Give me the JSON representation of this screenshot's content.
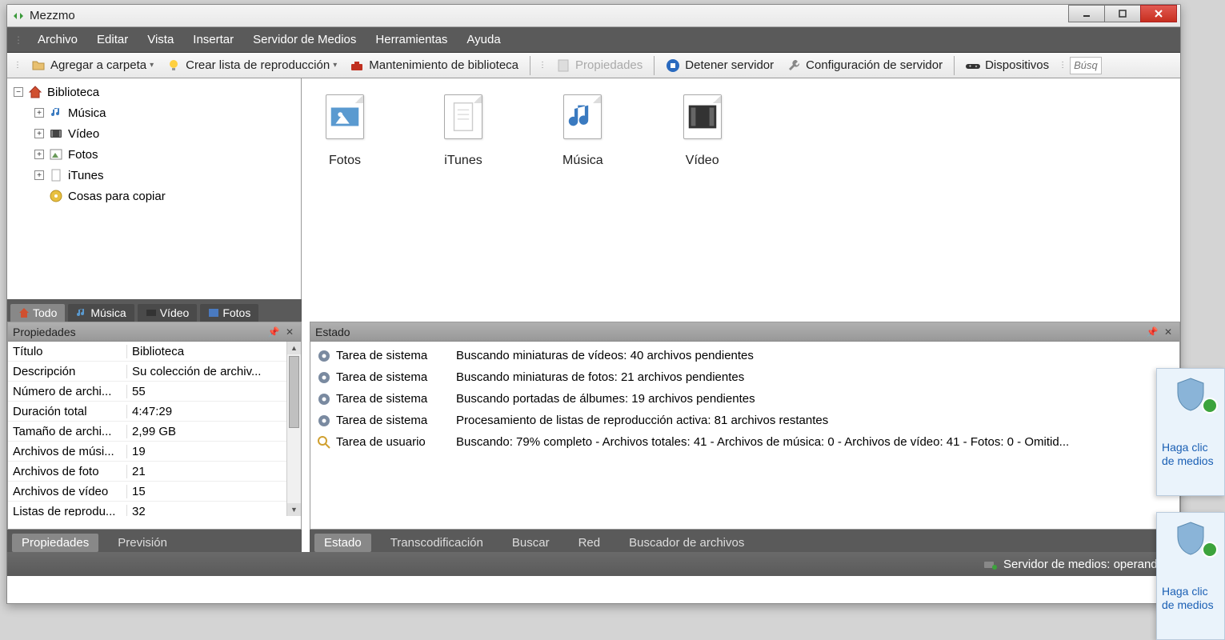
{
  "app": {
    "title": "Mezzmo"
  },
  "menu": [
    "Archivo",
    "Editar",
    "Vista",
    "Insertar",
    "Servidor de Medios",
    "Herramientas",
    "Ayuda"
  ],
  "toolbar": {
    "add_folder": "Agregar a carpeta",
    "create_playlist": "Crear lista de reproducción",
    "maintenance": "Mantenimiento de biblioteca",
    "properties": "Propiedades",
    "stop_server": "Detener servidor",
    "server_config": "Configuración de servidor",
    "devices": "Dispositivos",
    "search_placeholder": "Búsq"
  },
  "tree": {
    "root": "Biblioteca",
    "items": [
      {
        "label": "Música"
      },
      {
        "label": "Vídeo"
      },
      {
        "label": "Fotos"
      },
      {
        "label": "iTunes"
      },
      {
        "label": "Cosas para copiar"
      }
    ]
  },
  "content": [
    {
      "label": "Fotos",
      "icon": "photo"
    },
    {
      "label": "iTunes",
      "icon": "file"
    },
    {
      "label": "Música",
      "icon": "music"
    },
    {
      "label": "Vídeo",
      "icon": "video"
    }
  ],
  "filter_tabs": [
    "Todo",
    "Música",
    "Vídeo",
    "Fotos"
  ],
  "panels": {
    "properties_title": "Propiedades",
    "status_title": "Estado"
  },
  "properties": [
    {
      "k": "Título",
      "v": "Biblioteca"
    },
    {
      "k": "Descripción",
      "v": "Su colección de archiv..."
    },
    {
      "k": "Número de archi...",
      "v": "55"
    },
    {
      "k": "Duración total",
      "v": "4:47:29"
    },
    {
      "k": "Tamaño de archi...",
      "v": "2,99 GB"
    },
    {
      "k": "Archivos de músi...",
      "v": "19"
    },
    {
      "k": "Archivos de foto",
      "v": "21"
    },
    {
      "k": "Archivos de vídeo",
      "v": "15"
    },
    {
      "k": "Listas de reprodu...",
      "v": "32"
    }
  ],
  "status_rows": [
    {
      "kind": "Tarea de sistema",
      "msg": "Buscando miniaturas de vídeos: 40 archivos pendientes",
      "icon": "gear"
    },
    {
      "kind": "Tarea de sistema",
      "msg": "Buscando miniaturas de fotos: 21 archivos pendientes",
      "icon": "gear"
    },
    {
      "kind": "Tarea de sistema",
      "msg": "Buscando portadas de álbumes: 19 archivos pendientes",
      "icon": "gear"
    },
    {
      "kind": "Tarea de sistema",
      "msg": "Procesamiento de listas de reproducción activa: 81 archivos restantes",
      "icon": "gear"
    },
    {
      "kind": "Tarea de usuario",
      "msg": "Buscando: 79% completo - Archivos totales: 41 - Archivos de música: 0 - Archivos de vídeo: 41 - Fotos: 0 - Omitid...",
      "icon": "search"
    }
  ],
  "subtabs_left": [
    "Propiedades",
    "Previsión"
  ],
  "subtabs_right": [
    "Estado",
    "Transcodificación",
    "Buscar",
    "Red",
    "Buscador de archivos"
  ],
  "statusbar": {
    "server": "Servidor de medios: operando"
  },
  "notif": {
    "line1": "Haga clic",
    "line2": "de medios"
  }
}
